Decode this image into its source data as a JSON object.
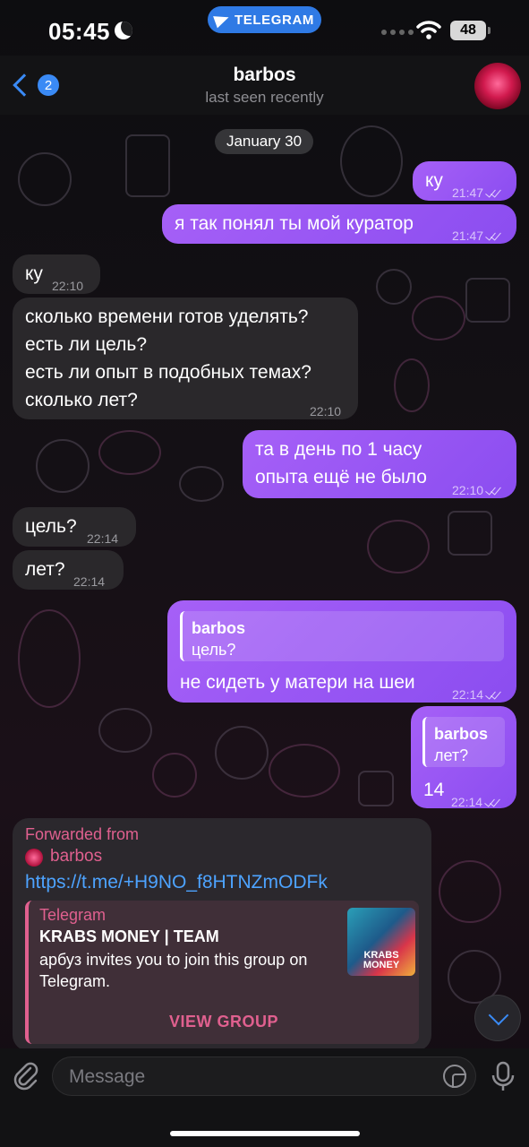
{
  "status_bar": {
    "time": "05:45",
    "app_pill": "TELEGRAM",
    "battery": "48"
  },
  "header": {
    "back_count": "2",
    "name": "barbos",
    "status": "last seen recently"
  },
  "date_separator": "January 30",
  "messages": [
    {
      "dir": "out",
      "text": "ку",
      "time": "21:47"
    },
    {
      "dir": "out",
      "text": "я так понял ты мой куратор",
      "time": "21:47"
    },
    {
      "dir": "in",
      "text": "ку",
      "time": "22:10"
    },
    {
      "dir": "in",
      "lines": [
        "сколько времени готов уделять?",
        "есть ли цель?",
        "есть ли опыт в подобных темах?",
        "сколько лет?"
      ],
      "time": "22:10"
    },
    {
      "dir": "out",
      "lines": [
        "та в день по 1 часу",
        "опыта ещё не было"
      ],
      "time": "22:10"
    },
    {
      "dir": "in",
      "text": "цель?",
      "time": "22:14"
    },
    {
      "dir": "in",
      "text": "лет?",
      "time": "22:14"
    },
    {
      "dir": "out",
      "reply_name": "barbos",
      "reply_text": "цель?",
      "text": "не сидеть у матери на шеи",
      "time": "22:14"
    },
    {
      "dir": "out",
      "reply_name": "barbos",
      "reply_text": "лет?",
      "text": "14",
      "time": "22:14"
    }
  ],
  "forwarded": {
    "label": "Forwarded from",
    "from": "barbos",
    "link": "https://t.me/+H9NO_f8HTNZmODFk",
    "preview": {
      "site": "Telegram",
      "title": "KRABS MONEY | TEAM",
      "description": "арбуз invites you to join this group on Telegram.",
      "thumb_text": "KRABS MONEY",
      "button": "VIEW GROUP"
    }
  },
  "input": {
    "placeholder": "Message"
  },
  "colors": {
    "outgoing": "#9a56f4",
    "incoming": "#2c2a2e",
    "accent": "#3a8af5",
    "forward": "#e0608f"
  }
}
